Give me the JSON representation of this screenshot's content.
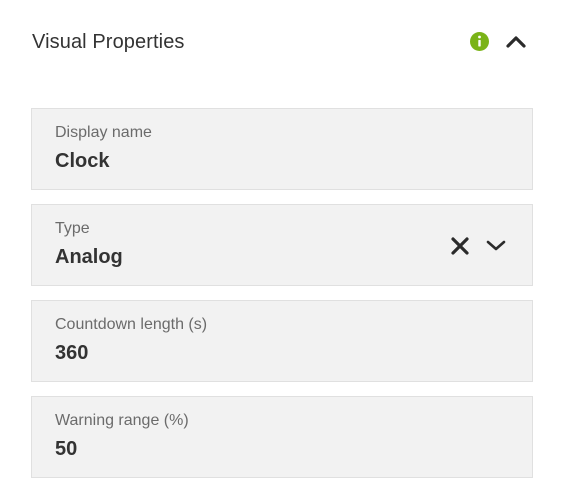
{
  "panel": {
    "title": "Visual Properties",
    "info_icon_color": "#7ab317",
    "icons": {
      "info": "info-icon",
      "collapse": "chevron-up-icon",
      "clear": "close-icon",
      "dropdown": "chevron-down-icon"
    }
  },
  "fields": {
    "display_name": {
      "label": "Display name",
      "value": "Clock"
    },
    "type": {
      "label": "Type",
      "value": "Analog"
    },
    "countdown_length": {
      "label": "Countdown length (s)",
      "value": "360"
    },
    "warning_range": {
      "label": "Warning range (%)",
      "value": "50"
    }
  }
}
